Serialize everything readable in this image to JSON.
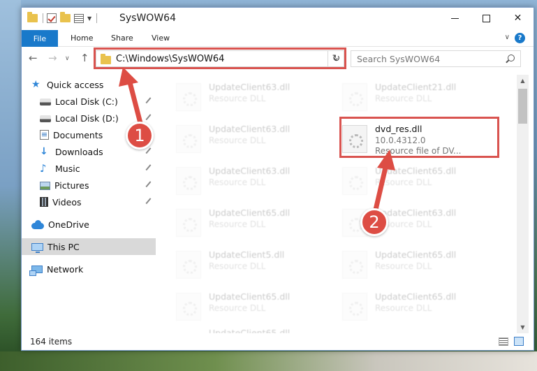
{
  "window": {
    "title": "SysWOW64"
  },
  "ribbon": {
    "tabs": [
      "File",
      "Home",
      "Share",
      "View"
    ],
    "help": "?"
  },
  "address": {
    "path": "C:\\Windows\\SysWOW64"
  },
  "search": {
    "placeholder": "Search SysWOW64"
  },
  "sidebar": {
    "items": [
      {
        "label": "Quick access",
        "icon": "star-icon",
        "pinned": false
      },
      {
        "label": "Local Disk (C:)",
        "icon": "drive-icon",
        "pinned": true
      },
      {
        "label": "Local Disk (D:)",
        "icon": "drive-icon",
        "pinned": true
      },
      {
        "label": "Documents",
        "icon": "documents-icon",
        "pinned": true
      },
      {
        "label": "Downloads",
        "icon": "download-icon",
        "pinned": true
      },
      {
        "label": "Music",
        "icon": "music-icon",
        "pinned": true
      },
      {
        "label": "Pictures",
        "icon": "pictures-icon",
        "pinned": true
      },
      {
        "label": "Videos",
        "icon": "videos-icon",
        "pinned": true
      },
      {
        "label": "OneDrive",
        "icon": "onedrive-icon",
        "pinned": false
      },
      {
        "label": "This PC",
        "icon": "this-pc-icon",
        "pinned": false
      },
      {
        "label": "Network",
        "icon": "network-icon",
        "pinned": false
      }
    ]
  },
  "files": {
    "left_column": [
      {
        "name": "UpdateClient63.dll",
        "desc": "Resource DLL"
      },
      {
        "name": "UpdateClient63.dll",
        "desc": "Resource DLL"
      },
      {
        "name": "UpdateClient63.dll",
        "desc": "Resource DLL"
      },
      {
        "name": "UpdateClient65.dll",
        "desc": "Resource DLL"
      },
      {
        "name": "UpdateClient5.dll",
        "desc": "Resource DLL"
      },
      {
        "name": "UpdateClient65.dll",
        "desc": "Resource DLL"
      },
      {
        "name": "UpdateClient65.dll",
        "desc": "Resource DLL"
      }
    ],
    "right_column": [
      {
        "name": "UpdateClient21.dll",
        "desc": "Resource DLL"
      },
      {
        "name": "UpdateClient65.dll",
        "desc": "Resource DLL"
      },
      {
        "name": "UpdateClient63.dll",
        "desc": "Resource DLL"
      },
      {
        "name": "UpdateClient65.dll",
        "desc": "Resource DLL"
      },
      {
        "name": "UpdateClient65.dll",
        "desc": "Resource DLL"
      }
    ],
    "highlighted": {
      "name": "dvd_res.dll",
      "version": "10.0.4312.0",
      "desc": "Resource file of DV..."
    }
  },
  "status": {
    "item_count": "164 items"
  },
  "callouts": {
    "step1": "1",
    "step2": "2"
  },
  "colors": {
    "accent": "#1979ca",
    "highlight_box": "#d9534f",
    "callout": "#dd4d44"
  }
}
